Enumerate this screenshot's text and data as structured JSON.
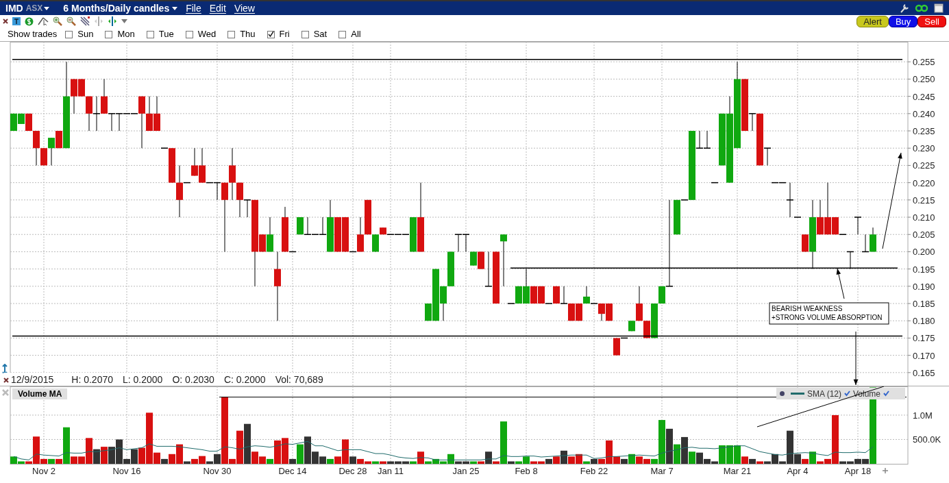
{
  "title_bar": {
    "symbol": "IMD",
    "exchange": "ASX",
    "period": "6 Months/Daily candles",
    "menu": [
      "File",
      "Edit",
      "View"
    ]
  },
  "action_buttons": [
    {
      "label": "Alert",
      "kind": "alert"
    },
    {
      "label": "Buy",
      "kind": "buy"
    },
    {
      "label": "Sell",
      "kind": "sell"
    }
  ],
  "show_trades": {
    "label": "Show trades",
    "days": [
      {
        "label": "Sun",
        "checked": false
      },
      {
        "label": "Mon",
        "checked": false
      },
      {
        "label": "Tue",
        "checked": false
      },
      {
        "label": "Wed",
        "checked": false
      },
      {
        "label": "Thu",
        "checked": false
      },
      {
        "label": "Fri",
        "checked": true
      },
      {
        "label": "Sat",
        "checked": false
      },
      {
        "label": "All",
        "checked": false
      }
    ]
  },
  "info_line": {
    "date": "12/9/2015",
    "values": [
      "H: 0.2070",
      "L: 0.2000",
      "O: 0.2030",
      "C: 0.2000",
      "Vol: 70,689"
    ]
  },
  "price_chart": {
    "chart_data": {
      "type": "candlestick",
      "grid": true,
      "ylim": [
        0.161,
        0.2608
      ],
      "yticks": [
        {
          "value": 0.165,
          "label": "0.165"
        },
        {
          "value": 0.17,
          "label": "0.170"
        },
        {
          "value": 0.175,
          "label": "0.175"
        },
        {
          "value": 0.18,
          "label": "0.180"
        },
        {
          "value": 0.185,
          "label": "0.185"
        },
        {
          "value": 0.19,
          "label": "0.190"
        },
        {
          "value": 0.195,
          "label": "0.195"
        },
        {
          "value": 0.2,
          "label": "0.200"
        },
        {
          "value": 0.205,
          "label": "0.205"
        },
        {
          "value": 0.21,
          "label": "0.210"
        },
        {
          "value": 0.215,
          "label": "0.215"
        },
        {
          "value": 0.22,
          "label": "0.220"
        },
        {
          "value": 0.225,
          "label": "0.225"
        },
        {
          "value": 0.23,
          "label": "0.230"
        },
        {
          "value": 0.235,
          "label": "0.235"
        },
        {
          "value": 0.24,
          "label": "0.240"
        },
        {
          "value": 0.245,
          "label": "0.245"
        },
        {
          "value": 0.25,
          "label": "0.250"
        },
        {
          "value": 0.255,
          "label": "0.255"
        }
      ],
      "categories": [
        null,
        null,
        null,
        null,
        null,
        null,
        null,
        null,
        null,
        null,
        null,
        null,
        null,
        null,
        null,
        null,
        null,
        null,
        null,
        null,
        null,
        null,
        null,
        null,
        null,
        null,
        null,
        null,
        null,
        null,
        null,
        null,
        null,
        null,
        null,
        null,
        null,
        null,
        null,
        null,
        null,
        null,
        null,
        null,
        null,
        null,
        null,
        null,
        null,
        null,
        null,
        null,
        null,
        null,
        null,
        null,
        null,
        null,
        null,
        null,
        null,
        null,
        null,
        null,
        null,
        null,
        null,
        null,
        null,
        null,
        null,
        null,
        null,
        null,
        null,
        null,
        null,
        null,
        null,
        null,
        null,
        null,
        null,
        null,
        null,
        null,
        null,
        null,
        null,
        null,
        null,
        null,
        null,
        null,
        null,
        null,
        null,
        null,
        null,
        null,
        null,
        null,
        null,
        null,
        null,
        null,
        null,
        null,
        null,
        null,
        null,
        null,
        null,
        null,
        null
      ],
      "ohlc": [
        [
          0.235,
          0.24,
          0.235,
          0.24
        ],
        [
          0.237,
          0.24,
          0.237,
          0.24
        ],
        [
          0.24,
          0.24,
          0.235,
          0.235
        ],
        [
          0.235,
          0.235,
          0.225,
          0.23
        ],
        [
          0.23,
          0.23,
          0.225,
          0.225
        ],
        [
          0.23,
          0.233,
          0.225,
          0.233
        ],
        [
          0.235,
          0.235,
          0.23,
          0.23
        ],
        [
          0.23,
          0.255,
          0.23,
          0.245
        ],
        [
          0.25,
          0.25,
          0.24,
          0.245
        ],
        [
          0.25,
          0.25,
          0.245,
          0.245
        ],
        [
          0.245,
          0.245,
          0.235,
          0.24
        ],
        [
          0.24,
          0.245,
          0.235,
          0.24
        ],
        [
          0.245,
          0.25,
          0.24,
          0.24
        ],
        [
          0.24,
          0.24,
          0.235,
          0.24
        ],
        [
          0.24,
          0.24,
          0.235,
          0.24
        ],
        [
          0.24,
          0.24,
          0.24,
          0.24
        ],
        [
          0.24,
          0.24,
          0.24,
          0.24
        ],
        [
          0.245,
          0.245,
          0.23,
          0.24
        ],
        [
          0.24,
          0.245,
          0.235,
          0.235
        ],
        [
          0.24,
          0.245,
          0.235,
          0.235
        ],
        [
          0.23,
          0.23,
          0.23,
          0.23
        ],
        [
          0.23,
          0.23,
          0.22,
          0.22
        ],
        [
          0.22,
          0.225,
          0.21,
          0.215
        ],
        [
          0.22,
          0.22,
          0.22,
          0.22
        ],
        [
          0.225,
          0.23,
          0.222,
          0.222
        ],
        [
          0.225,
          0.23,
          0.22,
          0.22
        ],
        [
          0.22,
          0.22,
          0.22,
          0.22
        ],
        [
          0.22,
          0.22,
          0.215,
          0.22
        ],
        [
          0.22,
          0.22,
          0.2,
          0.215
        ],
        [
          0.225,
          0.23,
          0.215,
          0.22
        ],
        [
          0.22,
          0.22,
          0.21,
          0.215
        ],
        [
          0.215,
          0.215,
          0.21,
          0.215
        ],
        [
          0.215,
          0.215,
          0.19,
          0.2
        ],
        [
          0.205,
          0.205,
          0.2,
          0.2
        ],
        [
          0.2,
          0.21,
          0.2,
          0.205
        ],
        [
          0.195,
          0.2,
          0.18,
          0.19
        ],
        [
          0.21,
          0.213,
          0.2,
          0.2
        ],
        [
          0.2,
          0.2,
          0.2,
          0.2
        ],
        [
          0.205,
          0.21,
          0.205,
          0.21
        ],
        [
          0.205,
          0.21,
          0.205,
          0.205
        ],
        [
          0.205,
          0.205,
          0.205,
          0.205
        ],
        [
          0.205,
          0.21,
          0.205,
          0.205
        ],
        [
          0.2,
          0.215,
          0.2,
          0.21
        ],
        [
          0.21,
          0.21,
          0.2,
          0.2
        ],
        [
          0.21,
          0.21,
          0.2,
          0.2
        ],
        [
          0.2,
          0.2,
          0.2,
          0.2
        ],
        [
          0.205,
          0.21,
          0.2,
          0.2
        ],
        [
          0.215,
          0.215,
          0.205,
          0.205
        ],
        [
          0.2,
          0.205,
          0.2,
          0.205
        ],
        [
          0.207,
          0.207,
          0.205,
          0.205
        ],
        [
          0.205,
          0.205,
          0.205,
          0.205
        ],
        [
          0.205,
          0.205,
          0.205,
          0.205
        ],
        [
          0.205,
          0.205,
          0.205,
          0.205
        ],
        [
          0.2,
          0.21,
          0.2,
          0.21
        ],
        [
          0.21,
          0.22,
          0.2,
          0.2
        ],
        [
          0.18,
          0.185,
          0.18,
          0.185
        ],
        [
          0.18,
          0.195,
          0.18,
          0.195
        ],
        [
          0.185,
          0.19,
          0.18,
          0.19
        ],
        [
          0.19,
          0.2,
          0.19,
          0.2
        ],
        [
          0.205,
          0.205,
          0.2,
          0.205
        ],
        [
          0.205,
          0.205,
          0.2,
          0.205
        ],
        [
          0.196,
          0.2,
          0.196,
          0.2
        ],
        [
          0.2,
          0.2,
          0.195,
          0.195
        ],
        [
          0.19,
          0.2,
          0.19,
          0.19
        ],
        [
          0.2,
          0.2,
          0.185,
          0.185
        ],
        [
          0.203,
          0.205,
          0.19,
          0.205
        ],
        [
          0.185,
          0.185,
          0.185,
          0.185
        ],
        [
          0.185,
          0.19,
          0.185,
          0.19
        ],
        [
          0.185,
          0.195,
          0.185,
          0.19
        ],
        [
          0.19,
          0.19,
          0.185,
          0.185
        ],
        [
          0.19,
          0.19,
          0.185,
          0.185
        ],
        [
          0.185,
          0.185,
          0.185,
          0.185
        ],
        [
          0.19,
          0.19,
          0.185,
          0.185
        ],
        [
          0.185,
          0.19,
          0.185,
          0.185
        ],
        [
          0.185,
          0.185,
          0.18,
          0.18
        ],
        [
          0.185,
          0.185,
          0.18,
          0.18
        ],
        [
          0.185,
          0.19,
          0.185,
          0.187
        ],
        [
          0.185,
          0.185,
          0.185,
          0.185
        ],
        [
          0.185,
          0.185,
          0.18,
          0.182
        ],
        [
          0.185,
          0.185,
          0.18,
          0.18
        ],
        [
          0.175,
          0.175,
          0.17,
          0.17
        ],
        [
          0.175,
          0.175,
          0.175,
          0.175
        ],
        [
          0.177,
          0.18,
          0.177,
          0.18
        ],
        [
          0.185,
          0.19,
          0.18,
          0.18
        ],
        [
          0.18,
          0.18,
          0.175,
          0.175
        ],
        [
          0.175,
          0.185,
          0.175,
          0.185
        ],
        [
          0.185,
          0.19,
          0.185,
          0.19
        ],
        [
          0.19,
          0.215,
          0.19,
          0.19
        ],
        [
          0.205,
          0.215,
          0.205,
          0.215
        ],
        [
          0.215,
          0.215,
          0.215,
          0.215
        ],
        [
          0.215,
          0.235,
          0.215,
          0.235
        ],
        [
          0.23,
          0.235,
          0.23,
          0.23
        ],
        [
          0.23,
          0.235,
          0.23,
          0.23
        ],
        [
          0.22,
          0.22,
          0.22,
          0.22
        ],
        [
          0.225,
          0.24,
          0.225,
          0.24
        ],
        [
          0.22,
          0.245,
          0.22,
          0.24
        ],
        [
          0.23,
          0.255,
          0.23,
          0.25
        ],
        [
          0.25,
          0.25,
          0.235,
          0.235
        ],
        [
          0.24,
          0.24,
          0.235,
          0.24
        ],
        [
          0.24,
          0.24,
          0.225,
          0.225
        ],
        [
          0.23,
          0.23,
          0.225,
          0.23
        ],
        [
          0.22,
          0.22,
          0.22,
          0.22
        ],
        [
          0.22,
          0.22,
          0.22,
          0.22
        ],
        [
          0.215,
          0.22,
          0.21,
          0.215
        ],
        [
          0.21,
          0.21,
          0.21,
          0.21
        ],
        [
          0.205,
          0.205,
          0.2,
          0.2
        ],
        [
          0.2,
          0.215,
          0.195,
          0.21
        ],
        [
          0.21,
          0.215,
          0.205,
          0.205
        ],
        [
          0.21,
          0.22,
          0.205,
          0.205
        ],
        [
          0.21,
          0.21,
          0.205,
          0.205
        ],
        [
          0.205,
          0.205,
          0.205,
          0.205
        ],
        [
          0.2,
          0.2,
          0.195,
          0.2
        ],
        [
          0.21,
          0.21,
          0.205,
          0.21
        ],
        [
          0.2,
          0.205,
          0.2,
          0.2
        ],
        [
          0.2,
          0.207,
          0.2,
          0.205
        ]
      ],
      "ref_lines": [
        {
          "axis": "y",
          "value": 0.2557
        },
        {
          "axis": "y",
          "value": 0.1756
        },
        {
          "axis": "y",
          "value": 0.1953
        }
      ],
      "annotations": [
        {
          "text": "BEARISH WEAKNESS"
        },
        {
          "text": "+STRONG VOLUME ABSORPTION"
        }
      ]
    }
  },
  "volume_panel": {
    "title": "Volume MA",
    "legend": [
      {
        "checked": true
      },
      {
        "checked": true
      }
    ],
    "chart_data": {
      "type": "bar",
      "grid": true,
      "ylim": [
        0,
        1590000
      ],
      "yticks": [
        {
          "value": 500000,
          "label": "500.0K"
        },
        {
          "value": 1000000,
          "label": "1.0M"
        }
      ],
      "categories": [
        null,
        null,
        null,
        null,
        "Nov 2",
        null,
        null,
        null,
        null,
        null,
        null,
        null,
        null,
        null,
        null,
        "Nov 16",
        null,
        null,
        null,
        null,
        null,
        null,
        null,
        null,
        null,
        null,
        null,
        "Nov 30",
        null,
        null,
        null,
        null,
        null,
        null,
        null,
        null,
        null,
        "Dec 14",
        null,
        null,
        null,
        null,
        null,
        null,
        null,
        "Dec 28",
        null,
        null,
        null,
        null,
        "Jan 11",
        null,
        null,
        null,
        null,
        null,
        null,
        null,
        null,
        null,
        "Jan 25",
        null,
        null,
        null,
        null,
        null,
        null,
        null,
        "Feb 8",
        null,
        null,
        null,
        null,
        null,
        null,
        null,
        null,
        "Feb 22",
        null,
        null,
        null,
        null,
        null,
        null,
        null,
        null,
        "Mar 7",
        null,
        null,
        null,
        null,
        null,
        null,
        null,
        null,
        null,
        "Mar 21",
        null,
        null,
        null,
        null,
        null,
        null,
        null,
        "Apr 4",
        null,
        null,
        null,
        null,
        null,
        null,
        null,
        "Apr 18",
        null,
        null
      ],
      "series": [
        {
          "name": "SMA (12)",
          "type": "line",
          "color": "#1f6b6b",
          "values": [
            150000,
            100000,
            80000,
            200000,
            180000,
            170000,
            160000,
            230000,
            220000,
            220000,
            250000,
            250000,
            270000,
            290000,
            330000,
            290000,
            310000,
            330000,
            410000,
            360000,
            360000,
            360000,
            350000,
            330000,
            310000,
            290000,
            260000,
            260000,
            350000,
            330000,
            300000,
            350000,
            370000,
            360000,
            340000,
            370000,
            410000,
            400000,
            430000,
            460000,
            370000,
            370000,
            320000,
            270000,
            290000,
            290000,
            290000,
            250000,
            210000,
            210000,
            180000,
            140000,
            120000,
            110000,
            130000,
            120000,
            80000,
            80000,
            80000,
            80000,
            80000,
            80000,
            80000,
            100000,
            100000,
            170000,
            150000,
            150000,
            160000,
            160000,
            140000,
            150000,
            160000,
            170000,
            180000,
            180000,
            180000,
            110000,
            120000,
            150000,
            150000,
            160000,
            170000,
            180000,
            170000,
            160000,
            220000,
            260000,
            290000,
            330000,
            340000,
            320000,
            320000,
            310000,
            330000,
            350000,
            370000,
            370000,
            310000,
            250000,
            220000,
            190000,
            180000,
            210000,
            220000,
            230000,
            220000,
            190000,
            170000,
            240000,
            230000,
            230000,
            240000,
            230000,
            350000
          ]
        },
        {
          "name": "Volume",
          "values": [
            150000,
            50000,
            50000,
            560000,
            100000,
            100000,
            100000,
            750000,
            150000,
            150000,
            530000,
            300000,
            350000,
            350000,
            500000,
            100000,
            300000,
            330000,
            1050000,
            230000,
            100000,
            200000,
            400000,
            50000,
            100000,
            160000,
            50000,
            200000,
            1370000,
            100000,
            680000,
            820000,
            250000,
            150000,
            100000,
            480000,
            530000,
            100000,
            400000,
            560000,
            250000,
            150000,
            100000,
            150000,
            500000,
            150000,
            100000,
            50000,
            50000,
            50000,
            50000,
            50000,
            50000,
            50000,
            250000,
            50000,
            100000,
            50000,
            200000,
            50000,
            50000,
            50000,
            50000,
            250000,
            50000,
            870000,
            50000,
            50000,
            150000,
            50000,
            50000,
            100000,
            150000,
            270000,
            150000,
            200000,
            50000,
            100000,
            100000,
            480000,
            150000,
            100000,
            200000,
            150000,
            100000,
            100000,
            900000,
            720000,
            400000,
            550000,
            250000,
            230000,
            100000,
            50000,
            380000,
            380000,
            380000,
            150000,
            100000,
            50000,
            50000,
            200000,
            50000,
            680000,
            200000,
            100000,
            250000,
            50000,
            100000,
            1000000,
            50000,
            50000,
            100000,
            100000,
            1570000
          ],
          "colors": [
            "#10a810",
            "#10a810",
            "#d81010",
            "#d81010",
            "#d81010",
            "#10a810",
            "#d81010",
            "#10a810",
            "#d81010",
            "#d81010",
            "#d81010",
            "#333333",
            "#d81010",
            "#333333",
            "#333333",
            "#333333",
            "#333333",
            "#d81010",
            "#d81010",
            "#d81010",
            "#333333",
            "#d81010",
            "#d81010",
            "#333333",
            "#d81010",
            "#d81010",
            "#333333",
            "#333333",
            "#d81010",
            "#d81010",
            "#d81010",
            "#333333",
            "#d81010",
            "#d81010",
            "#10a810",
            "#d81010",
            "#d81010",
            "#333333",
            "#10a810",
            "#333333",
            "#333333",
            "#333333",
            "#10a810",
            "#d81010",
            "#d81010",
            "#333333",
            "#d81010",
            "#d81010",
            "#10a810",
            "#d81010",
            "#333333",
            "#333333",
            "#333333",
            "#10a810",
            "#d81010",
            "#10a810",
            "#10a810",
            "#10a810",
            "#10a810",
            "#333333",
            "#333333",
            "#10a810",
            "#d81010",
            "#333333",
            "#d81010",
            "#10a810",
            "#333333",
            "#10a810",
            "#10a810",
            "#d81010",
            "#d81010",
            "#333333",
            "#d81010",
            "#333333",
            "#d81010",
            "#d81010",
            "#10a810",
            "#333333",
            "#d81010",
            "#d81010",
            "#d81010",
            "#333333",
            "#10a810",
            "#d81010",
            "#d81010",
            "#10a810",
            "#10a810",
            "#333333",
            "#10a810",
            "#333333",
            "#10a810",
            "#333333",
            "#333333",
            "#333333",
            "#10a810",
            "#10a810",
            "#10a810",
            "#d81010",
            "#333333",
            "#d81010",
            "#333333",
            "#333333",
            "#333333",
            "#333333",
            "#333333",
            "#d81010",
            "#10a810",
            "#d81010",
            "#d81010",
            "#d81010",
            "#333333",
            "#333333",
            "#333333",
            "#333333",
            "#10a810"
          ]
        }
      ],
      "ref_lines": [
        {
          "axis": "y",
          "value": 1370000
        }
      ]
    }
  }
}
